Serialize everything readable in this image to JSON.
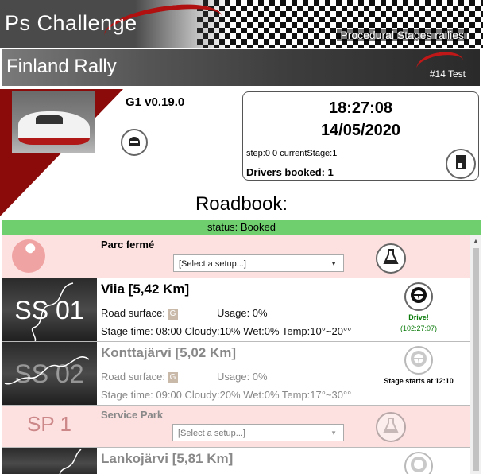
{
  "header": {
    "app_title": "Ps Challenge",
    "subtitle": "Procedural Stages rallies"
  },
  "rally": {
    "title": "Finland Rally",
    "badge": "#14 Test"
  },
  "info": {
    "version": "G1 v0.19.0",
    "time": "18:27:08",
    "date": "14/05/2020",
    "step_line": "step:0 0 currentStage:1",
    "drivers_booked": "Drivers booked: 1"
  },
  "roadbook": {
    "title": "Roadbook:",
    "status": "status: Booked"
  },
  "rows": [
    {
      "kind": "parc",
      "title": "Parc fermé",
      "select_value": "[Select a setup...]"
    },
    {
      "kind": "stage",
      "thumb_label": "SS 01",
      "title": "Viia [5,42 Km]",
      "road_surface_label": "Road surface:",
      "surface_code": "G",
      "usage": "Usage: 0%",
      "weather": "Stage time: 08:00  Cloudy:10%  Wet:0%  Temp:10°~20°°",
      "action_label": "Drive!",
      "action_time": "(102:27:07)"
    },
    {
      "kind": "stage",
      "thumb_label": "SS 02",
      "title": "Konttajärvi [5,02 Km]",
      "road_surface_label": "Road surface:",
      "surface_code": "G",
      "usage": "Usage: 0%",
      "weather": "Stage time: 09:00  Cloudy:20%  Wet:0%  Temp:17°~30°°",
      "starts_text": "Stage starts at 12:10"
    },
    {
      "kind": "service",
      "thumb_label": "SP 1",
      "title": "Service Park",
      "select_value": "[Select a setup...]"
    },
    {
      "kind": "stage",
      "title": "Lankojärvi [5,81 Km]"
    }
  ],
  "icons": {
    "helmet": "helmet-icon",
    "book": "book-icon",
    "flask": "flask-icon",
    "wheel": "steering-wheel-icon",
    "wrench": "wrench-icon"
  },
  "colors": {
    "status_green": "#6fcf6f",
    "pink_row": "#fde0e0",
    "accent_red": "#8b0a0a",
    "drive_green": "#0a7a0a"
  }
}
